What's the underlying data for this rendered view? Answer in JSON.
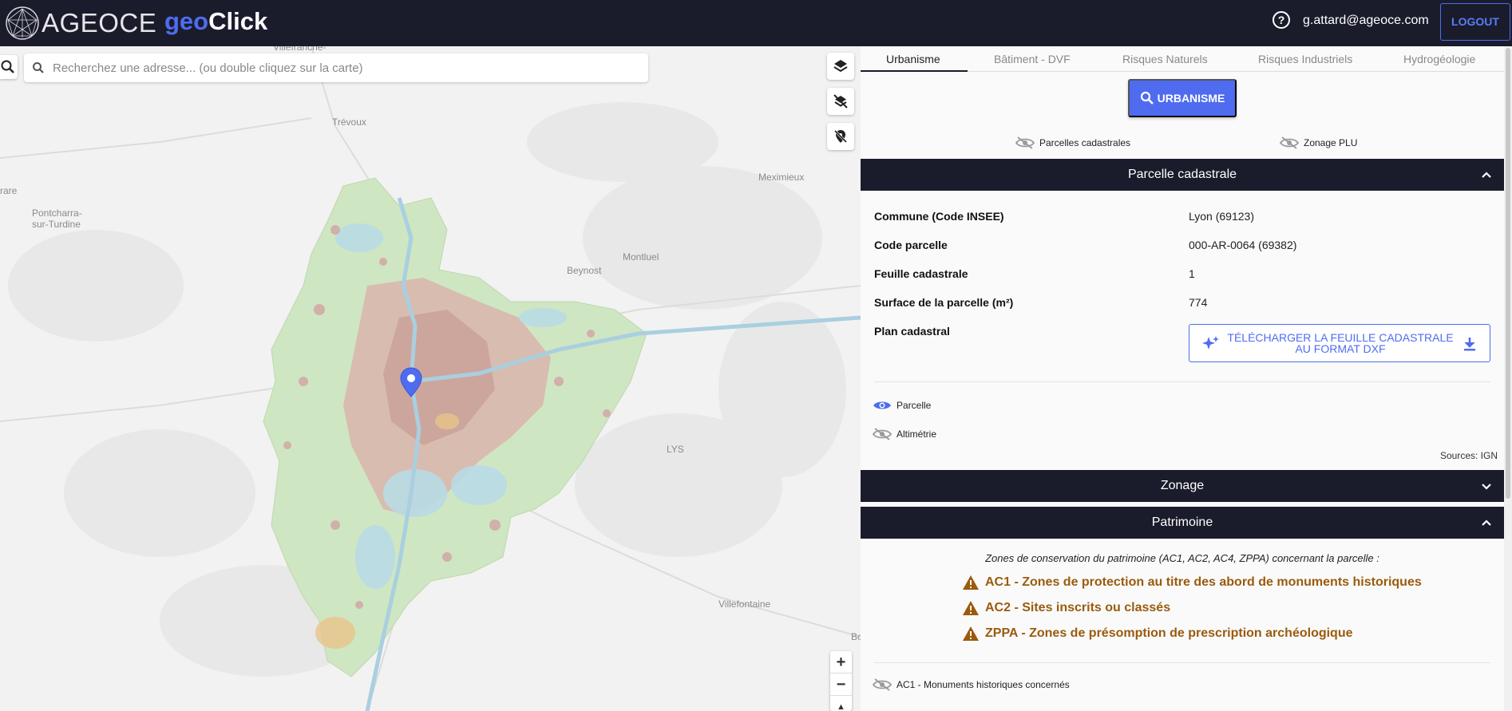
{
  "header": {
    "logo_text": "AGEOCE",
    "brand_geo": "geo",
    "brand_click": "Click",
    "help_symbol": "?",
    "user_email": "g.attard@ageoce.com",
    "logout_label": "LOGOUT"
  },
  "search": {
    "placeholder": "Recherchez une adresse... (ou double cliquez sur la carte)"
  },
  "map": {
    "labels": [
      "Villefranche-",
      "Trévoux",
      "rare",
      "Pontcharra-",
      "sur-Turdine",
      "Meximieux",
      "Montluel",
      "Beynost",
      "LYS",
      "Villefontaine",
      "Bo"
    ],
    "zoom_in": "+",
    "zoom_out": "−",
    "compass": "▲"
  },
  "tabs": [
    {
      "label": "Urbanisme",
      "active": true
    },
    {
      "label": "Bâtiment - DVF",
      "active": false
    },
    {
      "label": "Risques Naturels",
      "active": false
    },
    {
      "label": "Risques Industriels",
      "active": false
    },
    {
      "label": "Hydrogéologie",
      "active": false
    }
  ],
  "urbanisme_button": "URBANISME",
  "layer_toggles": {
    "parcelles": "Parcelles cadastrales",
    "zonage": "Zonage PLU"
  },
  "parcelle_section": {
    "title": "Parcelle cadastrale",
    "rows": [
      {
        "label": "Commune (Code INSEE)",
        "value": "Lyon (69123)"
      },
      {
        "label": "Code parcelle",
        "value": "000-AR-0064 (69382)"
      },
      {
        "label": "Feuille cadastrale",
        "value": "1"
      },
      {
        "label": "Surface de la parcelle (m²)",
        "value": "774"
      },
      {
        "label": "Plan cadastral",
        "value": ""
      }
    ],
    "dxf_button": "TÉLÉCHARGER LA FEUILLE CADASTRALE AU FORMAT DXF",
    "toggle_parcelle": "Parcelle",
    "toggle_altimetrie": "Altimétrie",
    "sources": "Sources: IGN"
  },
  "zonage_section": {
    "title": "Zonage"
  },
  "patrimoine_section": {
    "title": "Patrimoine",
    "intro": "Zones de conservation du patrimoine (AC1, AC2, AC4, ZPPA) concernant la parcelle :",
    "warnings": [
      "AC1 - Zones de protection au titre des abord de monuments historiques",
      "AC2 - Sites inscrits ou classés",
      "ZPPA - Zones de présomption de prescription archéologique"
    ],
    "monuments_toggle": "AC1 - Monuments historiques concernés"
  },
  "colors": {
    "header_bg": "#1a1c2c",
    "accent": "#4f6cf0",
    "warning": "#9a5b0e"
  }
}
